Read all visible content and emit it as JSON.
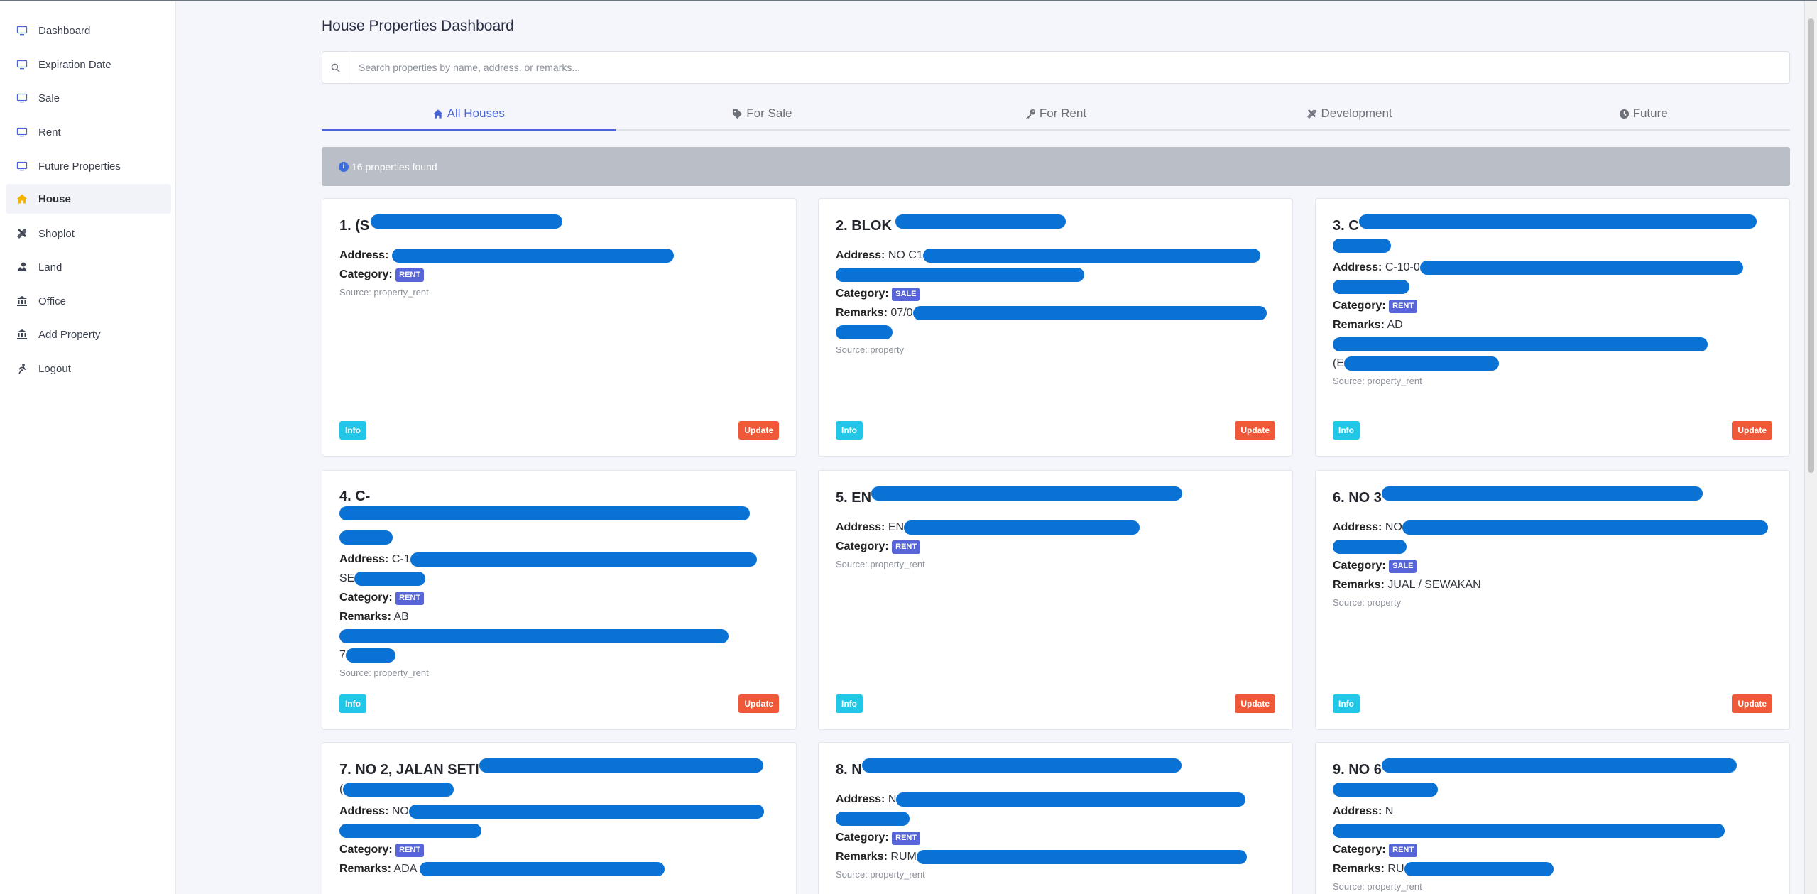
{
  "sidebar": {
    "items": [
      {
        "label": "Dashboard",
        "icon": "monitor-icon"
      },
      {
        "label": "Expiration Date",
        "icon": "monitor-icon"
      },
      {
        "label": "Sale",
        "icon": "monitor-icon"
      },
      {
        "label": "Rent",
        "icon": "monitor-icon"
      },
      {
        "label": "Future Properties",
        "icon": "monitor-icon"
      },
      {
        "label": "House",
        "icon": "home-icon"
      },
      {
        "label": "Shoplot",
        "icon": "tools-icon"
      },
      {
        "label": "Land",
        "icon": "map-icon"
      },
      {
        "label": "Office",
        "icon": "bank-icon"
      },
      {
        "label": "Add Property",
        "icon": "bank-icon"
      },
      {
        "label": "Logout",
        "icon": "logout-icon"
      }
    ],
    "active": "House",
    "accent": "#f5b301"
  },
  "main": {
    "title": "House Properties Dashboard",
    "search_placeholder": "Search properties by name, address, or remarks...",
    "tabs": [
      {
        "label": "All Houses",
        "icon": "home-icon"
      },
      {
        "label": "For Sale",
        "icon": "tag-icon"
      },
      {
        "label": "For Rent",
        "icon": "key-icon"
      },
      {
        "label": "Development",
        "icon": "tools-icon"
      },
      {
        "label": "Future",
        "icon": "clock-icon"
      }
    ],
    "result_text": "16 properties found"
  },
  "labels": {
    "address": "Address:",
    "category": "Category:",
    "remarks": "Remarks:",
    "info": "Info",
    "update": "Update"
  },
  "cards": [
    {
      "title": "1. (S",
      "address": "",
      "category": "RENT",
      "source": "Source: property_rent"
    },
    {
      "title": "2. BLOK",
      "address": "NO C1",
      "address_line2": "",
      "category": "SALE",
      "remarks": "07/0",
      "remarks_line2": "",
      "source": "Source: property"
    },
    {
      "title": "3. C",
      "address": "C-10-0",
      "category": "RENT",
      "remarks": "AD",
      "remarks_line2": "(E",
      "source": "Source: property_rent"
    },
    {
      "title": "4. C-",
      "address": "C-1",
      "address_line2": "SE",
      "category": "RENT",
      "remarks": "AB",
      "remarks_line2": "7",
      "source": "Source: property_rent"
    },
    {
      "title": "5. EN",
      "address": "EN",
      "category": "RENT",
      "source": "Source: property_rent"
    },
    {
      "title": "6. NO 3",
      "address": "NO",
      "address_line2": "",
      "category": "SALE",
      "remarks": "JUAL / SEWAKAN",
      "source": "Source: property"
    },
    {
      "title": "7. NO 2, JALAN SETI",
      "title_line2": "(",
      "address": "NO",
      "category": "RENT",
      "remarks": "ADA"
    },
    {
      "title": "8. N",
      "address": "N",
      "category": "RENT",
      "remarks": "RUM",
      "source": "Source: property_rent"
    },
    {
      "title": "9. NO 6",
      "address": "N",
      "category": "RENT",
      "remarks": "RU",
      "source": "Source: property_rent"
    }
  ],
  "colors": {
    "primary": "#4a63d6",
    "info_button": "#22c7e8",
    "update_button": "#f0583a",
    "badge": "#5865d8",
    "redaction": "#0a72d4"
  }
}
